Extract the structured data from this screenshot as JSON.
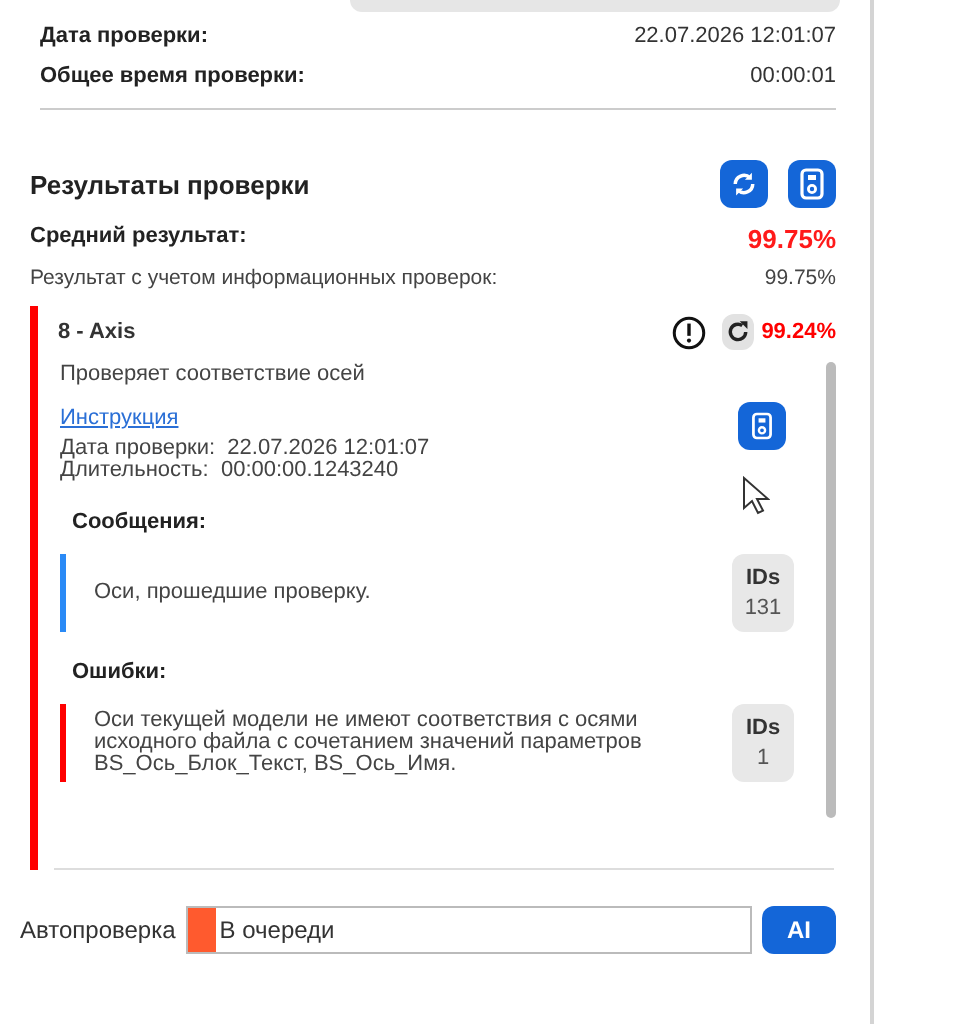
{
  "summary": [
    {
      "label": "Дата проверки:",
      "value": "22.07.2026 12:01:07"
    },
    {
      "label": "Общее время проверки:",
      "value": "00:00:01"
    }
  ],
  "results": {
    "title": "Результаты проверки",
    "average_label": "Средний результат:",
    "average_value": "99.75%",
    "info_label": "Результат с учетом информационных проверок:",
    "info_value": "99.75%"
  },
  "check": {
    "name": "8 - Axis",
    "result": "99.24%",
    "color": "#ff0000",
    "description": "Проверяет соответствие осей",
    "link": "Инструкция",
    "date_label": "Дата проверки:",
    "date_value": "22.07.2026 12:01:07",
    "duration_label": "Длительность:",
    "duration_value": "00:00:00.1243240",
    "sections": [
      {
        "title": "Сообщения:",
        "items": [
          {
            "text": "Оси, прошедшие проверку.",
            "ids_label": "IDs",
            "ids_count": "131",
            "color": "#2a8af6"
          }
        ]
      },
      {
        "title": "Ошибки:",
        "items": [
          {
            "text": "Оси текущей модели не имеют соответствия с осями исходного файла с сочетанием значений параметров BS_Ось_Блок_Текст, BS_Ось_Имя.",
            "ids_label": "IDs",
            "ids_count": "1",
            "color": "#ff0000"
          }
        ]
      }
    ]
  },
  "autocheck": {
    "label": "Автопроверка",
    "status": "В очереди",
    "level": 0.05,
    "button": "AI"
  }
}
